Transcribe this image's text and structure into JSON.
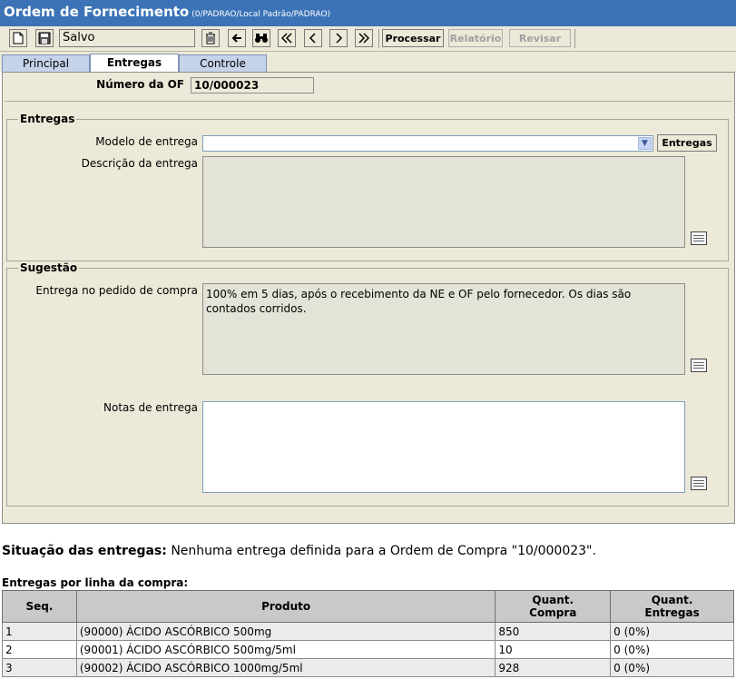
{
  "window": {
    "title": "Ordem de Fornecimento",
    "subtitle": "(0/PADRAO/Local Padrão/PADRAO)"
  },
  "toolbar": {
    "status": "Salvo",
    "processar_label": "Processar",
    "relatorio_label": "Relatório",
    "revisar_label": "Revisar"
  },
  "tabs": [
    {
      "label": "Principal"
    },
    {
      "label": "Entregas"
    },
    {
      "label": "Controle"
    }
  ],
  "of": {
    "label": "Número da OF",
    "value": "10/000023"
  },
  "entregas_group": {
    "legend": "Entregas",
    "modelo_label": "Modelo de entrega",
    "modelo_value": "",
    "entregas_button": "Entregas",
    "descricao_label": "Descrição da entrega",
    "descricao_value": ""
  },
  "sugestao_group": {
    "legend": "Sugestão",
    "pedido_label": "Entrega no pedido de compra",
    "pedido_value": "100% em 5 dias, após o recebimento da NE e OF pelo fornecedor. Os dias são contados corridos.",
    "notas_label": "Notas de entrega",
    "notas_value": ""
  },
  "situacao": {
    "label": "Situação das entregas:",
    "text": "Nenhuma entrega definida para a Ordem de Compra \"10/000023\"."
  },
  "linhas": {
    "title": "Entregas por linha da compra:",
    "headers": {
      "seq": "Seq.",
      "produto": "Produto",
      "qc_line1": "Quant.",
      "qc_line2": "Compra",
      "qe_line1": "Quant.",
      "qe_line2": "Entregas"
    },
    "rows": [
      {
        "seq": "1",
        "produto": "(90000) ÁCIDO ASCÓRBICO 500mg",
        "compra": "850",
        "entregas": "0 (0%)"
      },
      {
        "seq": "2",
        "produto": "(90001) ÁCIDO ASCÓRBICO 500mg/5ml",
        "compra": "10",
        "entregas": "0 (0%)"
      },
      {
        "seq": "3",
        "produto": "(90002) ÁCIDO ASCÓRBICO 1000mg/5ml",
        "compra": "928",
        "entregas": "0 (0%)"
      }
    ]
  },
  "colors": {
    "titlebar": "#3b73b6",
    "panel": "#ece9d8",
    "tab_active": "#ffffff",
    "tab_inactive": "#c5d3ea"
  }
}
